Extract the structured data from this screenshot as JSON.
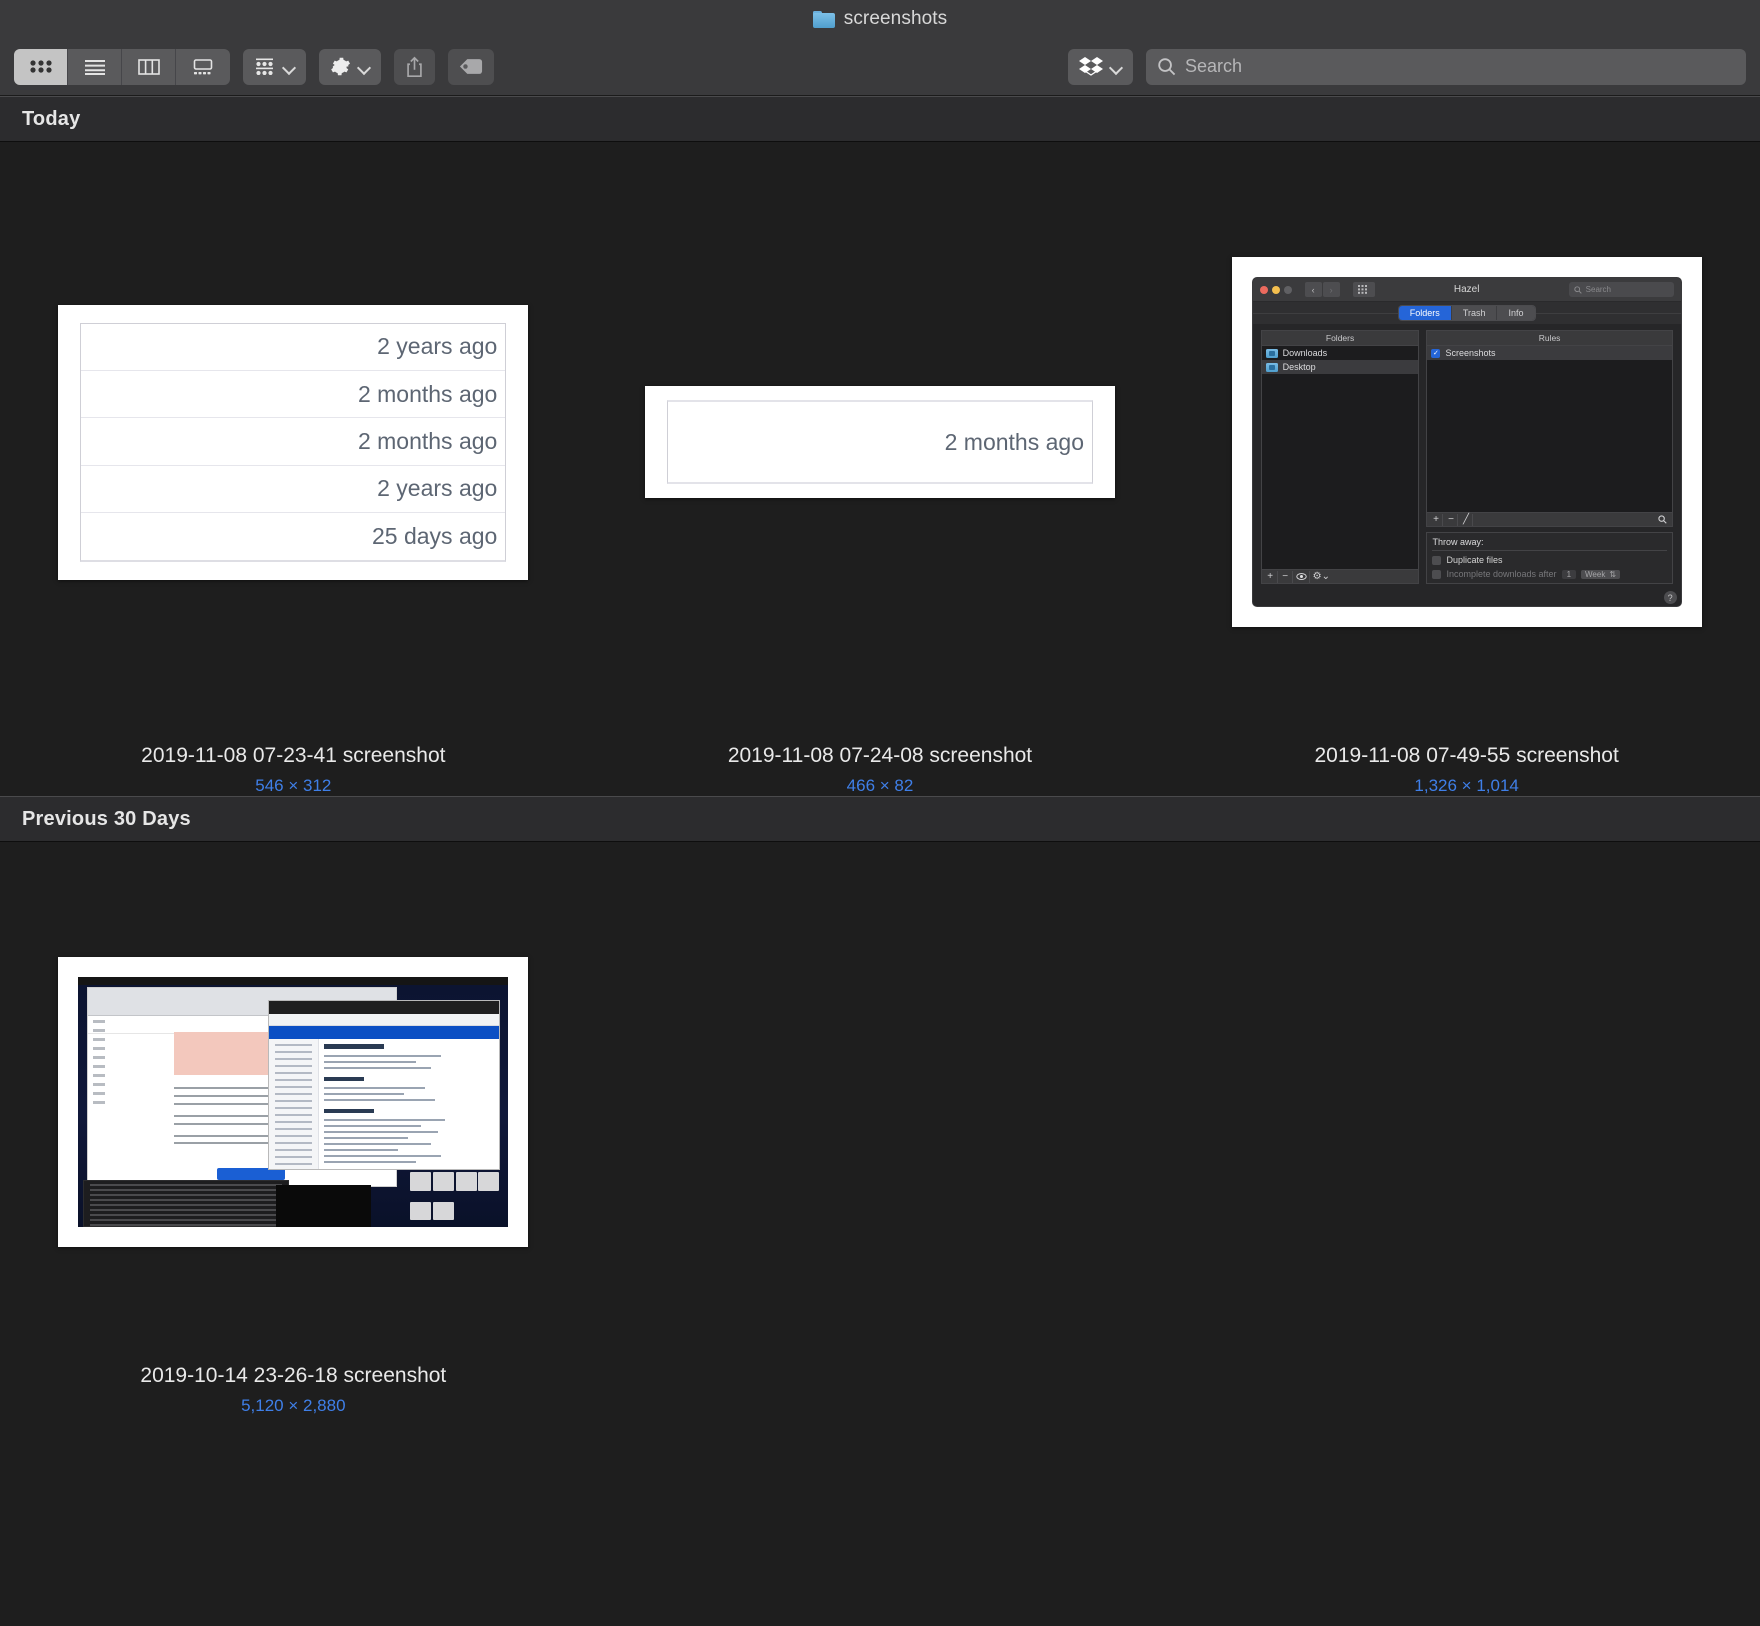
{
  "window": {
    "title": "screenshots",
    "folder_icon": "folder-icon"
  },
  "toolbar": {
    "view_buttons": [
      {
        "name": "icon-view",
        "icon": "grid-icon",
        "active": true
      },
      {
        "name": "list-view",
        "icon": "list-icon",
        "active": false
      },
      {
        "name": "column-view",
        "icon": "columns-icon",
        "active": false
      },
      {
        "name": "gallery-view",
        "icon": "gallery-icon",
        "active": false
      }
    ],
    "group_button": {
      "icon": "group-grid-icon",
      "chevron": "chevron-down-icon"
    },
    "action_button": {
      "icon": "gear-icon",
      "chevron": "chevron-down-icon"
    },
    "share_button": {
      "icon": "share-icon"
    },
    "tag_button": {
      "icon": "tag-icon"
    },
    "dropbox_button": {
      "icon": "dropbox-icon",
      "chevron": "chevron-down-icon"
    },
    "search": {
      "icon": "search-icon",
      "placeholder": "Search",
      "value": ""
    }
  },
  "sections": [
    {
      "header": "Today",
      "items": [
        {
          "name": "2019-11-08 07-23-41 screenshot",
          "dimensions": "546 × 312",
          "preview": {
            "type": "date-table",
            "rows": [
              "2 years ago",
              "2 months ago",
              "2 months ago",
              "2 years ago",
              "25 days ago"
            ]
          }
        },
        {
          "name": "2019-11-08 07-24-08 screenshot",
          "dimensions": "466 × 82",
          "preview": {
            "type": "date-table",
            "rows": [
              "2 months ago"
            ]
          }
        },
        {
          "name": "2019-11-08 07-49-55 screenshot",
          "dimensions": "1,326 × 1,014",
          "preview": {
            "type": "hazel-window",
            "app_title": "Hazel",
            "search_placeholder": "Search",
            "tabs": [
              "Folders",
              "Trash",
              "Info"
            ],
            "selected_tab": "Folders",
            "folders_pane": {
              "header": "Folders",
              "items": [
                "Downloads",
                "Desktop"
              ],
              "selected": "Desktop",
              "footer_buttons": [
                "+",
                "−",
                "eye-icon",
                "gear-icon"
              ]
            },
            "rules_pane": {
              "header": "Rules",
              "items": [
                "Screenshots"
              ],
              "checked": true,
              "footer_buttons": [
                "+",
                "−",
                "pencil-icon",
                "search-icon"
              ]
            },
            "throw_away": {
              "header": "Throw away:",
              "duplicate_files": "Duplicate files",
              "incomplete_downloads": "Incomplete downloads after",
              "amount": "1",
              "unit": "Week"
            },
            "help_button": "?"
          }
        }
      ]
    },
    {
      "header": "Previous 30 Days",
      "items": [
        {
          "name": "2019-10-14 23-26-18 screenshot",
          "dimensions": "5,120 × 2,880",
          "preview": {
            "type": "desktop-screenshot"
          }
        }
      ]
    }
  ],
  "colors": {
    "window_bg": "#1e1e1e",
    "chrome_bg": "#3a3a3c",
    "section_header_bg": "#2c2c2e",
    "accent_link": "#3f7fe8",
    "selection_blue": "#2565d8"
  }
}
